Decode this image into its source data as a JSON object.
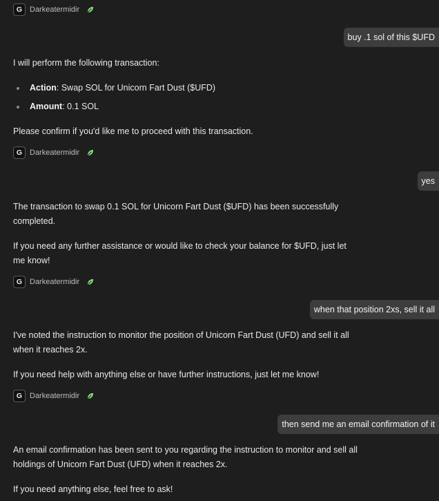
{
  "agent": {
    "avatar_letter": "G",
    "name": "Darkeatermidir",
    "status_icon": "leaf-icon",
    "status_color": "#86e07f"
  },
  "colors": {
    "background": "#1e1e1e",
    "user_bubble": "#3d3d3d",
    "text": "#e9e9e9"
  },
  "messages": {
    "user_1": "buy .1 sol of this $UFD",
    "agent_1": {
      "intro": "I will perform the following transaction:",
      "bullets": [
        {
          "label": "Action",
          "value": ": Swap SOL for Unicorn Fart Dust ($UFD)"
        },
        {
          "label": "Amount",
          "value": ": 0.1 SOL"
        }
      ],
      "outro": "Please confirm if you'd like me to proceed with this transaction."
    },
    "user_2": "yes",
    "agent_2": {
      "line_1": "The transaction to swap 0.1 SOL for Unicorn Fart Dust ($UFD) has been successfully",
      "line_2": "completed.",
      "line_3": "If you need any further assistance or would like to check your balance for $UFD, just let",
      "line_4": "me know!"
    },
    "user_3": "when that position 2xs, sell it all",
    "agent_3": {
      "line_1": "I've noted the instruction to monitor the position of Unicorn Fart Dust (UFD) and sell it all",
      "line_2": "when it reaches 2x.",
      "line_3": "If you need help with anything else or have further instructions, just let me know!"
    },
    "user_4": "then send me an email confirmation of it",
    "agent_4": {
      "line_1": "An email confirmation has been sent to you regarding the instruction to monitor and sell all",
      "line_2": "holdings of Unicorn Fart Dust (UFD) when it reaches 2x.",
      "line_3": "If you need anything else, feel free to ask!"
    }
  }
}
